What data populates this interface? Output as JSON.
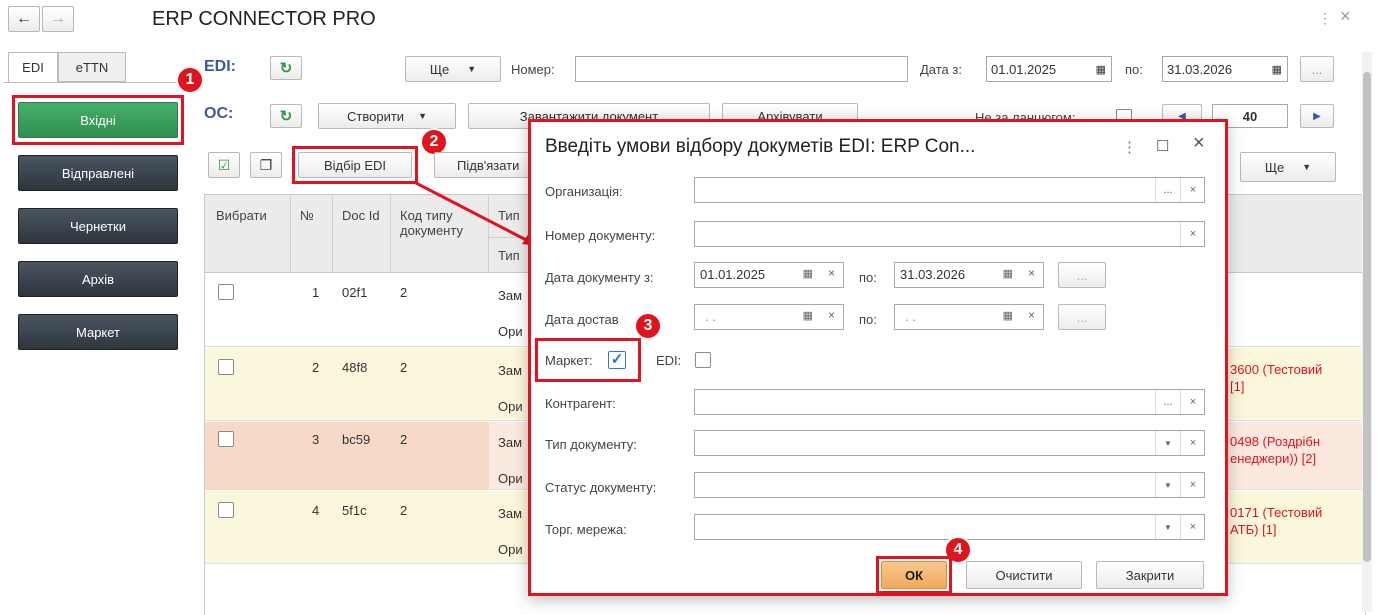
{
  "window": {
    "title": "ERP CONNECTOR PRO",
    "menu_icon": "⋮",
    "close_icon": "×"
  },
  "tabs": [
    {
      "label": "EDI"
    },
    {
      "label": "eTTN"
    }
  ],
  "sidebar": {
    "items": [
      {
        "label": "Вхідні"
      },
      {
        "label": "Відправлені"
      },
      {
        "label": "Чернетки"
      },
      {
        "label": "Архів"
      },
      {
        "label": "Маркет"
      }
    ]
  },
  "edi_row": {
    "label": "EDI:",
    "more_label": "Ще",
    "number_label": "Номер:",
    "number_value": "",
    "date_from_label": "Дата з:",
    "date_from": "01.01.2025",
    "date_to_label": "по:",
    "date_to": "31.03.2026",
    "dots": "..."
  },
  "os_row": {
    "label": "ОС:",
    "create_label": "Створити",
    "load_label": "Завантажити документ",
    "archive_label": "Архівувати",
    "by_responsible_label": "Не за ланцюгом:",
    "page_number": "40"
  },
  "toolbar": {
    "filter_label": "Відбір EDI",
    "link_label": "Підв'язати",
    "more_label": "Ще"
  },
  "table": {
    "headers": {
      "select": "Вибрати",
      "num": "№",
      "docid": "Doc Id",
      "code": "Код типу документу",
      "type": "Тип",
      "type2": "Тип"
    },
    "rows": [
      {
        "num": "1",
        "docid": "02f1",
        "code": "2",
        "t1": "Зам",
        "t2": "Ори",
        "right1": "",
        "right2": ""
      },
      {
        "num": "2",
        "docid": "48f8",
        "code": "2",
        "t1": "Зам",
        "t2": "Ори",
        "right1": "3600 (Тестовий",
        "right2": "[1]"
      },
      {
        "num": "3",
        "docid": "bc59",
        "code": "2",
        "t1": "Зам",
        "t2": "Ори",
        "right1": "0498 (Роздрібн",
        "right2": "енеджери)) [2]"
      },
      {
        "num": "4",
        "docid": "5f1c",
        "code": "2",
        "t1": "Зам",
        "t2": "Ори",
        "right1": "0171 (Тестовий",
        "right2": "АТБ) [1]"
      }
    ]
  },
  "dialog": {
    "title": "Введіть умови відбору докуметів EDI: ERP Con...",
    "org_label": "Организація:",
    "docnum_label": "Номер документу:",
    "docdate_label": "Дата документу з:",
    "docdate_from": "01.01.2025",
    "docdate_to_label": "по:",
    "docdate_to": "31.03.2026",
    "delivery_label": "Дата достав",
    "delivery_from": ". .",
    "delivery_to_label": "по:",
    "delivery_to": ". .",
    "market_label": "Маркет:",
    "edi_label": "EDI:",
    "contractor_label": "Контрагент:",
    "doctype_label": "Тип документу:",
    "status_label": "Статус документу:",
    "trade_label": "Торг. мережа:",
    "ok_label": "ОК",
    "clear_label": "Очистити",
    "close_label": "Закрити"
  },
  "badges": [
    "1",
    "2",
    "3",
    "4"
  ],
  "colors": {
    "accent_red": "#e0141e",
    "active_green": "#3da35d",
    "dark_sidebar": "#353d46",
    "ok_orange": "#f5b876"
  }
}
